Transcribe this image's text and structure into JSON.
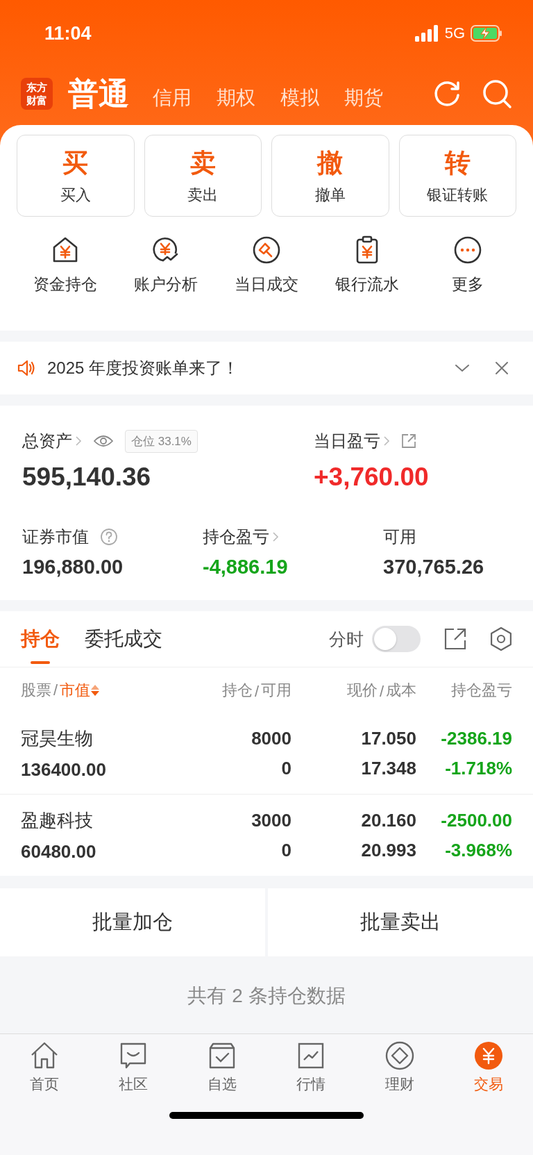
{
  "status_bar": {
    "time": "11:04",
    "network": "5G"
  },
  "header": {
    "logo": "东方财富",
    "account_tabs": [
      {
        "label": "普通",
        "selected": true
      },
      {
        "label": "信用",
        "selected": false
      },
      {
        "label": "期权",
        "selected": false
      },
      {
        "label": "模拟",
        "selected": false
      },
      {
        "label": "期货",
        "selected": false
      }
    ]
  },
  "quick_actions": [
    {
      "char": "买",
      "label": "买入"
    },
    {
      "char": "卖",
      "label": "卖出"
    },
    {
      "char": "撤",
      "label": "撤单"
    },
    {
      "char": "转",
      "label": "银证转账"
    }
  ],
  "tools": [
    "资金持仓",
    "账户分析",
    "当日成交",
    "银行流水",
    "更多"
  ],
  "banner": {
    "text": "2025 年度投资账单来了！"
  },
  "assets": {
    "total_label": "总资产",
    "position_badge": "仓位 33.1%",
    "total_value": "595,140.36",
    "daily_label": "当日盈亏",
    "daily_value": {
      "text": "+3,760.00",
      "color": "#f02a2a"
    },
    "metrics": [
      {
        "label": "证券市值",
        "value": "196,880.00",
        "kind": "help"
      },
      {
        "label": "持仓盈亏",
        "value": "-4,886.19",
        "color": "#16a51b",
        "kind": "link"
      },
      {
        "label": "可用",
        "value": "370,765.26",
        "kind": "plain"
      }
    ]
  },
  "holdings": {
    "tabs": [
      {
        "label": "持仓",
        "selected": true
      },
      {
        "label": "委托成交",
        "selected": false
      }
    ],
    "intraday_label": "分时",
    "intraday_on": false,
    "columns": [
      {
        "separator": "/",
        "parts": [
          {
            "text": "股票",
            "sorted": false
          },
          {
            "text": "市值",
            "sorted": true
          }
        ]
      },
      {
        "separator": "/",
        "parts": [
          {
            "text": "持仓",
            "sorted": false
          },
          {
            "text": "可用",
            "sorted": false
          }
        ]
      },
      {
        "separator": "/",
        "parts": [
          {
            "text": "现价",
            "sorted": false
          },
          {
            "text": "成本",
            "sorted": false
          }
        ]
      },
      {
        "parts": [
          {
            "text": "持仓盈亏",
            "sorted": false
          }
        ]
      }
    ],
    "rows": [
      {
        "name": "冠昊生物",
        "market_value": "136400.00",
        "quantity": "8000",
        "available": "0",
        "price": "17.050",
        "cost": "17.348",
        "pnl": "-2386.19",
        "pnl_pct": "-1.718%",
        "color": "#16a51b"
      },
      {
        "name": "盈趣科技",
        "market_value": "60480.00",
        "quantity": "3000",
        "available": "0",
        "price": "20.160",
        "cost": "20.993",
        "pnl": "-2500.00",
        "pnl_pct": "-3.968%",
        "color": "#16a51b"
      }
    ]
  },
  "batch_buttons": [
    "批量加仓",
    "批量卖出"
  ],
  "summary": "共有 2 条持仓数据",
  "nav": [
    {
      "label": "首页",
      "selected": false
    },
    {
      "label": "社区",
      "selected": false
    },
    {
      "label": "自选",
      "selected": false
    },
    {
      "label": "行情",
      "selected": false
    },
    {
      "label": "理财",
      "selected": false
    },
    {
      "label": "交易",
      "selected": true
    }
  ]
}
